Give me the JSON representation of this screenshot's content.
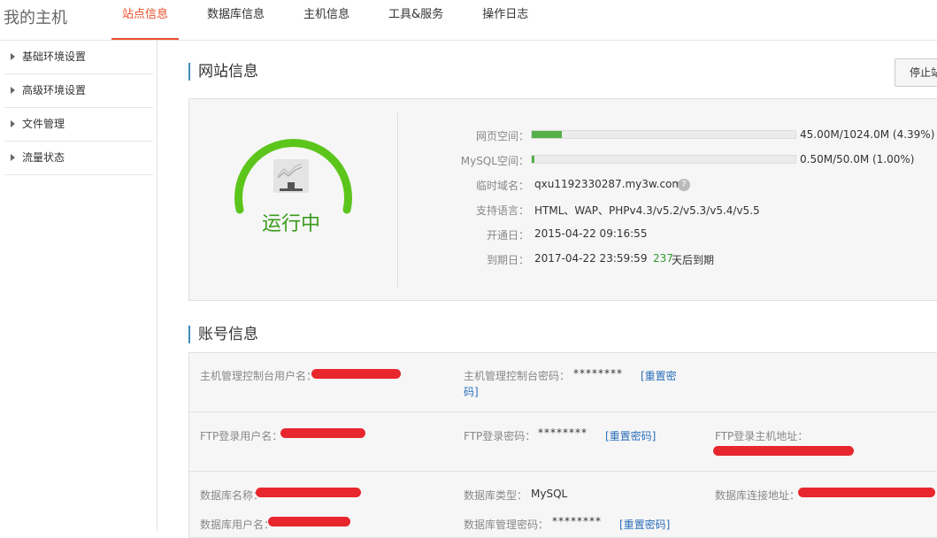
{
  "brand": "我的主机",
  "nav": [
    "站点信息",
    "数据库信息",
    "主机信息",
    "工具&服务",
    "操作日志"
  ],
  "sidebar": [
    "基础环境设置",
    "高级环境设置",
    "文件管理",
    "流量状态"
  ],
  "site_section": {
    "title": "网站信息",
    "stop_button": "停止站"
  },
  "status": {
    "text": "运行中"
  },
  "site_info": {
    "web_space_label": "网页空间：",
    "web_space_value": "45.00M/1024.0M (4.39%)",
    "web_space_fraction": 0.0439,
    "mysql_space_label": "MySQL空间：",
    "mysql_space_value": "0.50M/50.0M (1.00%)",
    "mysql_space_fraction": 0.01,
    "temp_domain_label": "临时域名：",
    "temp_domain_value": "qxu1192330287.my3w.com",
    "help": "?",
    "lang_label": "支持语言：",
    "lang_value": "HTML、WAP、PHPv4.3/v5.2/v5.3/v5.4/v5.5",
    "open_label": "开通日：",
    "open_value": "2015-04-22 09:16:55",
    "expire_label": "到期日：",
    "expire_value": "2017-04-22 23:59:59",
    "days_left": "237",
    "days_suffix": "天后到期"
  },
  "account_section": {
    "title": "账号信息"
  },
  "account": {
    "console_user_label": "主机管理控制台用户名：",
    "console_pwd_label": "主机管理控制台密码：",
    "console_pwd_value": "********",
    "reset_pwd": "[重置密码]",
    "reset_pwd_line1": "[重置密",
    "reset_pwd_line2": "码]",
    "ftp_user_label": "FTP登录用户名：",
    "ftp_pwd_label": "FTP登录密码：",
    "ftp_pwd_value": "********",
    "ftp_host_label": "FTP登录主机地址：",
    "db_name_label": "数据库名称：",
    "db_type_label": "数据库类型：",
    "db_type_value": "MySQL",
    "db_addr_label": "数据库连接地址：",
    "db_user_label": "数据库用户名：",
    "db_pwd_label": "数据库管理密码：",
    "db_pwd_value": "********"
  },
  "colors": {
    "accent": "#e8502e",
    "running": "#3a9b1e",
    "gauge": "#5cc51b",
    "link": "#2a6ebb",
    "redaction": "#e8262d"
  }
}
